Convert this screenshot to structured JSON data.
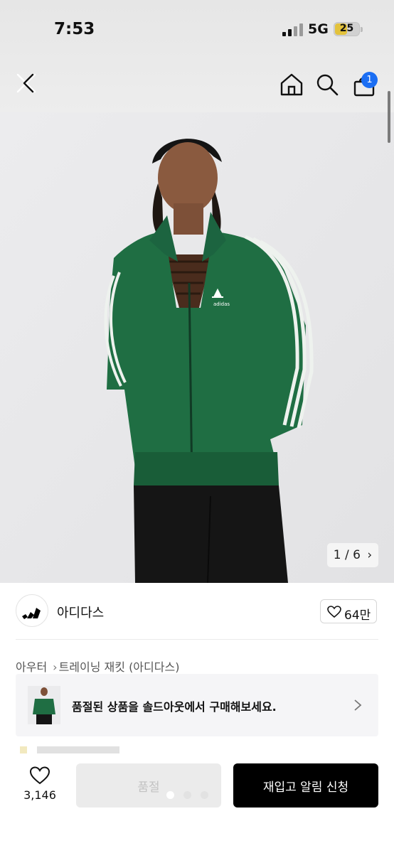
{
  "status_bar": {
    "time": "7:53",
    "network": "5G",
    "battery": "25",
    "battery_level": 0.25,
    "battery_color": "#e3c23b"
  },
  "nav": {
    "back_icon": "back-icon",
    "home_icon": "home-icon",
    "search_icon": "search-icon",
    "cart_icon": "shopping-bag-icon",
    "cart_badge": "1",
    "badge_color": "#1b6ef3"
  },
  "gallery": {
    "counter": "1 / 6",
    "current": 1,
    "total": 6
  },
  "brand": {
    "name": "아디다스",
    "likes": "64만"
  },
  "breadcrumb": [
    "아우터",
    "트레이닝 재킷 (아디다스)"
  ],
  "soldout_banner": {
    "text": "품절된 상품을 솔드아웃에서 구매해보세요."
  },
  "bottom_bar": {
    "wish_count": "3,146",
    "soldout_label": "품절",
    "restock_label": "재입고 알림 신청"
  }
}
